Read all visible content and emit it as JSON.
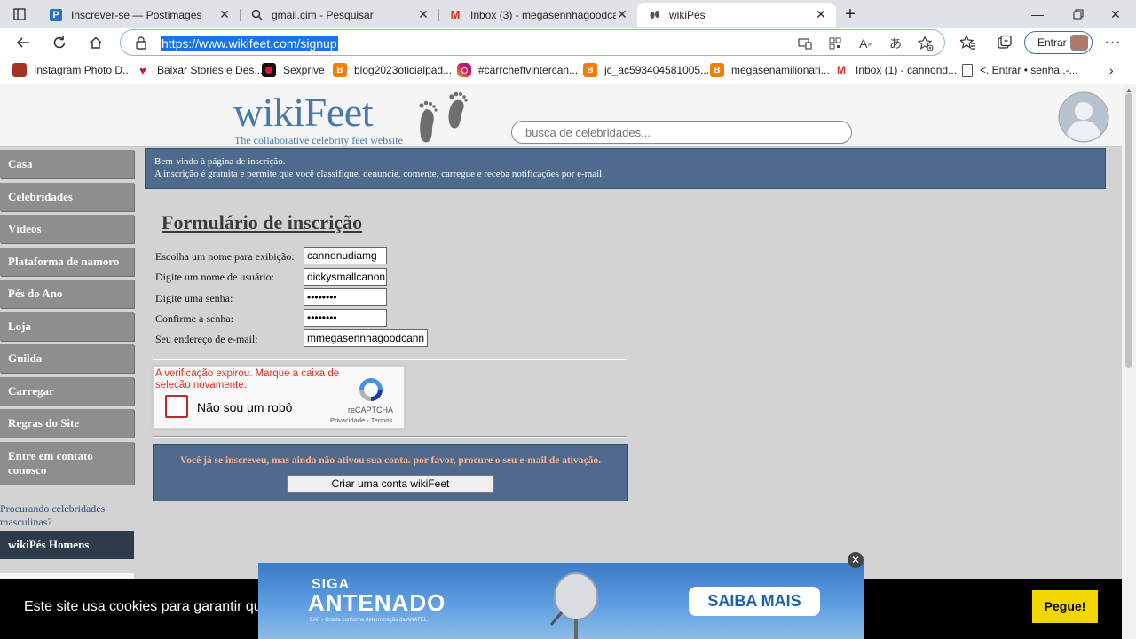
{
  "browser": {
    "tabs": [
      {
        "title": "Inscrever-se — Postimages",
        "icon": "postimages-favicon"
      },
      {
        "title": "gmail.cim - Pesquisar",
        "icon": "search-favicon"
      },
      {
        "title": "Inbox (3) - megasennhagoodcan",
        "icon": "gmail-favicon"
      },
      {
        "title": "wikiPés",
        "icon": "wikifeet-favicon"
      }
    ],
    "url": "https://www.wikifeet.com/signup",
    "signin_label": "Entrar",
    "bookmarks": [
      {
        "label": "Instagram Photo D...",
        "icon": "bookmark-icon"
      },
      {
        "label": "Baixar Stories e Des...",
        "icon": "heart-icon"
      },
      {
        "label": "Sexprive",
        "icon": "site-icon"
      },
      {
        "label": "blog2023oficialpad...",
        "icon": "blogger-icon"
      },
      {
        "label": "#carrcheftvintercan...",
        "icon": "instagram-icon"
      },
      {
        "label": "jc_ac593404581005...",
        "icon": "blogger-icon"
      },
      {
        "label": "megasenamilionari...",
        "icon": "blogger-icon"
      },
      {
        "label": "Inbox (1) - cannond...",
        "icon": "gmail-icon"
      },
      {
        "label": "<. Entrar •  senha .-...",
        "icon": "page-icon"
      }
    ]
  },
  "site": {
    "logo_text": "wikiFeet",
    "tagline": "The collaborative celebrity feet website",
    "search_placeholder": "busca de celebridades..."
  },
  "sidebar": {
    "items": [
      {
        "label": "Casa"
      },
      {
        "label": "Celebridades"
      },
      {
        "label": "Vídeos"
      },
      {
        "label": "Plataforma de namoro"
      },
      {
        "label": "Pés do Ano"
      },
      {
        "label": "Loja"
      },
      {
        "label": "Guilda"
      },
      {
        "label": "Carregar"
      },
      {
        "label": "Regras do Site"
      },
      {
        "label": "Entre em contato conosco"
      }
    ],
    "men_note": "Procurando celebridades masculinas?",
    "men_link": "wikiPés Homens"
  },
  "welcome": {
    "line1": "Bem-vindo à página de inscrição.",
    "line2": "A inscrição é gratuita e permite que você classifique, denuncie, comente, carregue e receba notificações por e-mail."
  },
  "form": {
    "title": "Formulário de inscrição",
    "fields": [
      {
        "label": "Escolha um nome para exibição:",
        "value": "cannonudiamg"
      },
      {
        "label": "Digite um nome de usuário:",
        "value": "dickysmallcanon"
      },
      {
        "label": "Digite uma senha:",
        "value": "••••••••"
      },
      {
        "label": "Confirme a senha:",
        "value": "••••••••"
      },
      {
        "label": "Seu endereço de e-mail:",
        "value": "mmegasennhagoodcann"
      }
    ]
  },
  "captcha": {
    "error": "A verificação expirou. Marque a caixa de seleção novamente.",
    "label": "Não sou um robô",
    "brand": "reCAPTCHA",
    "links": "Privacidade - Termos"
  },
  "notice": {
    "message": "Você já se inscreveu, mas ainda não ativou sua conta. por favor, procure o seu e-mail de ativação.",
    "button": "Criar uma conta wikiFeet"
  },
  "cookie": {
    "text": "Este site usa cookies para garantir que",
    "accept": "Pegue!"
  },
  "ad": {
    "line1": "SIGA",
    "line2": "ANTENADO",
    "sub": "EAF • Criada conforme determinação da ANATEL",
    "cta": "SAIBA MAIS"
  },
  "colors": {
    "nav_bg": "#8e8e8e",
    "panel_blue": "#4e6a8c",
    "notice_text": "#ffb08c",
    "cookie_button": "#f1d600"
  }
}
